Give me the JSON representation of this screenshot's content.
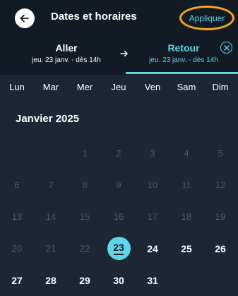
{
  "header": {
    "title": "Dates et horaires",
    "apply_label": "Appliquer",
    "highlight_color": "#f5a623",
    "accent_color": "#5ed5e8"
  },
  "trip": {
    "outbound": {
      "label": "Aller",
      "date": "jeu. 23 janv. - dès 14h"
    },
    "return": {
      "label": "Retour",
      "date": "jeu. 23 janv. - dès 14h"
    }
  },
  "weekdays": [
    "Lun",
    "Mar",
    "Mer",
    "Jeu",
    "Ven",
    "Sam",
    "Dim"
  ],
  "month_label": "Janvier 2025",
  "weeks": [
    [
      {
        "d": "",
        "s": "empty"
      },
      {
        "d": "",
        "s": "empty"
      },
      {
        "d": "1",
        "s": "dim"
      },
      {
        "d": "2",
        "s": "dim"
      },
      {
        "d": "3",
        "s": "dim"
      },
      {
        "d": "4",
        "s": "dim"
      },
      {
        "d": "5",
        "s": "dim"
      }
    ],
    [
      {
        "d": "6",
        "s": "dim"
      },
      {
        "d": "7",
        "s": "dim"
      },
      {
        "d": "8",
        "s": "dim"
      },
      {
        "d": "9",
        "s": "dim"
      },
      {
        "d": "10",
        "s": "dim"
      },
      {
        "d": "11",
        "s": "dim"
      },
      {
        "d": "12",
        "s": "dim"
      }
    ],
    [
      {
        "d": "13",
        "s": "dim"
      },
      {
        "d": "14",
        "s": "dim"
      },
      {
        "d": "15",
        "s": "dim"
      },
      {
        "d": "16",
        "s": "dim"
      },
      {
        "d": "17",
        "s": "dim"
      },
      {
        "d": "18",
        "s": "dim"
      },
      {
        "d": "19",
        "s": "dim"
      }
    ],
    [
      {
        "d": "20",
        "s": "dim"
      },
      {
        "d": "21",
        "s": "dim"
      },
      {
        "d": "22",
        "s": "dim"
      },
      {
        "d": "23",
        "s": "selected"
      },
      {
        "d": "24",
        "s": "active"
      },
      {
        "d": "25",
        "s": "active"
      },
      {
        "d": "26",
        "s": "active"
      }
    ],
    [
      {
        "d": "27",
        "s": "active"
      },
      {
        "d": "28",
        "s": "active"
      },
      {
        "d": "29",
        "s": "active"
      },
      {
        "d": "30",
        "s": "active"
      },
      {
        "d": "31",
        "s": "active"
      },
      {
        "d": "",
        "s": "empty"
      },
      {
        "d": "",
        "s": "empty"
      }
    ]
  ]
}
